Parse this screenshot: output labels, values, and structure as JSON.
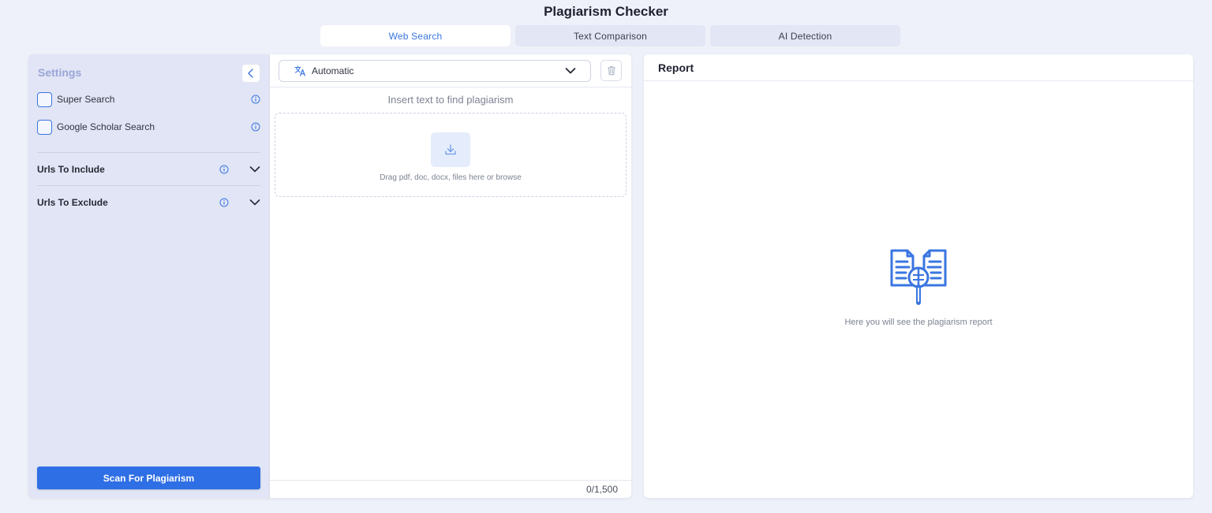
{
  "app": {
    "title": "Plagiarism Checker"
  },
  "tabs": [
    {
      "label": "Web Search",
      "active": true
    },
    {
      "label": "Text Comparison",
      "active": false
    },
    {
      "label": "AI Detection",
      "active": false
    }
  ],
  "settings": {
    "title": "Settings",
    "collapse_icon": "chevron-left-icon",
    "options": [
      {
        "label": "Super Search",
        "checked": false,
        "icon": "info-icon"
      },
      {
        "label": "Google Scholar Search",
        "checked": false,
        "icon": "info-icon"
      }
    ],
    "sections": [
      {
        "label": "Urls To Include",
        "expanded": false,
        "icon": "chevron-down-icon"
      },
      {
        "label": "Urls To Exclude",
        "expanded": false,
        "icon": "chevron-down-icon"
      }
    ],
    "scan_label": "Scan For Plagiarism"
  },
  "input": {
    "language": {
      "value": "Automatic",
      "icon": "translate-icon"
    },
    "trash_icon": "trash-icon",
    "hint": "Insert text to find plagiarism",
    "dropzone": {
      "icon": "download-icon",
      "text": "Drag pdf, doc, docx, files here or browse"
    },
    "char_count": "0/1,500"
  },
  "report": {
    "title": "Report",
    "illustration": "documents-magnifier-icon",
    "empty_text": "Here you will see the plagiarism report"
  },
  "colors": {
    "accent": "#2f6fe5",
    "tab_active_text": "#3a76e0",
    "page_bg": "#eef1f9",
    "settings_bg": "#e1e5f5"
  }
}
